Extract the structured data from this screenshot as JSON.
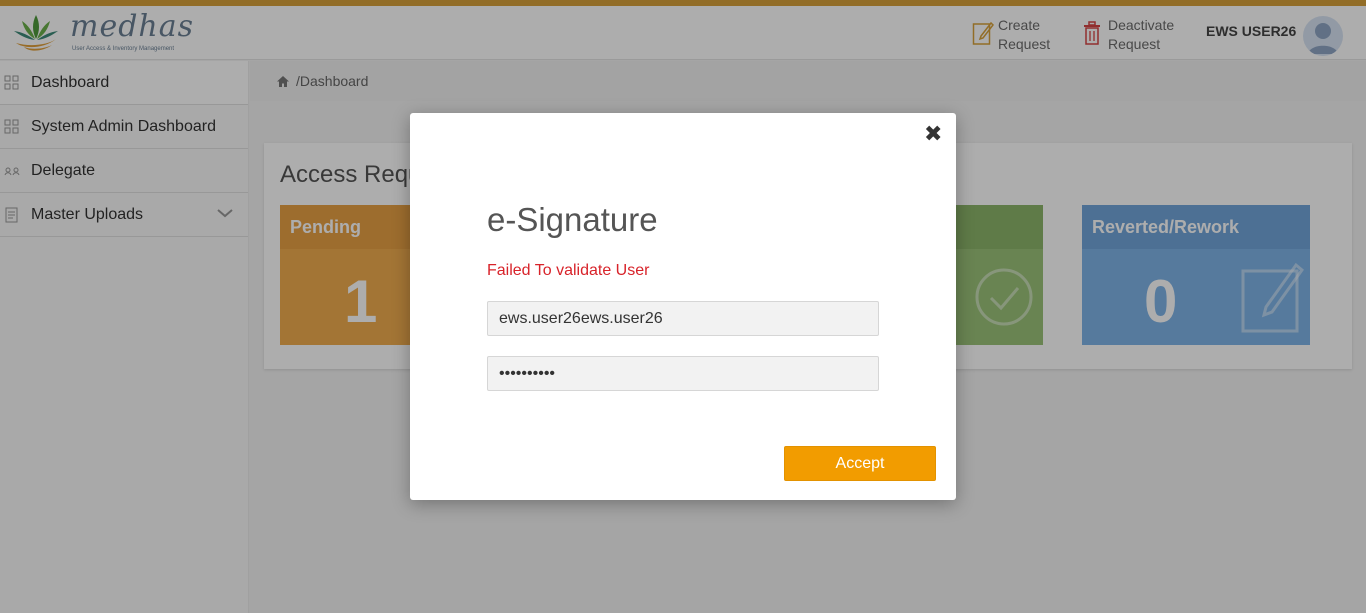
{
  "app": {
    "logo_name": "medhas",
    "logo_subtitle": "User Access & Inventory Management"
  },
  "header": {
    "create_request": {
      "line1": "Create",
      "line2": "Request",
      "icon": "edit-icon"
    },
    "deactivate_request": {
      "line1": "Deactivate",
      "line2": "Request",
      "icon": "trash-icon"
    },
    "user_name": "EWS USER26"
  },
  "sidebar": {
    "items": [
      {
        "label": "Dashboard",
        "icon": "grid-icon"
      },
      {
        "label": "System Admin Dashboard",
        "icon": "grid-icon"
      },
      {
        "label": "Delegate",
        "icon": "users-icon"
      },
      {
        "label": "Master Uploads",
        "icon": "document-icon"
      }
    ]
  },
  "breadcrumb": {
    "text": "/Dashboard"
  },
  "panel": {
    "title": "Access Requests",
    "tiles": [
      {
        "label": "Pending",
        "count": "1",
        "color": "#f0ad4e"
      },
      {
        "label": "",
        "count": "",
        "color": "#9bc37a"
      },
      {
        "label": "Reverted/Rework",
        "count": "0",
        "color": "#7fb4e8"
      }
    ]
  },
  "modal": {
    "title": "e-Signature",
    "error": "Failed To validate User",
    "username_value": "ews.user26ews.user26",
    "password_value": "••••••••••",
    "accept_label": "Accept",
    "close_glyph": "✖"
  },
  "colors": {
    "accent": "#f29c00",
    "error": "#d8232a",
    "top_bar": "#d8a13a"
  }
}
